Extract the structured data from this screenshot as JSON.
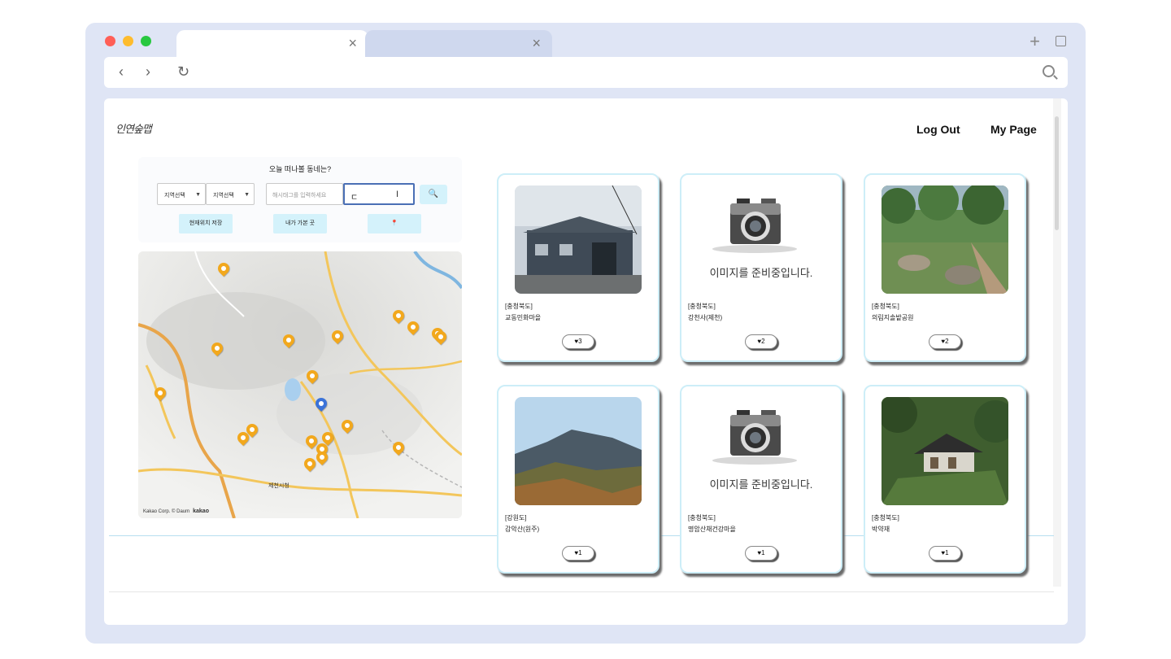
{
  "browser": {
    "tab_close": "×",
    "new_tab": "+",
    "nav_back": "‹",
    "nav_forward": "›",
    "nav_reload": "↻"
  },
  "header": {
    "logo_text": "인연숲맵",
    "logout_label": "Log Out",
    "mypage_label": "My Page"
  },
  "search": {
    "title": "오늘 떠나볼 동네는?",
    "region_select_1": "지역선택",
    "region_select_2": "지역선택",
    "hashtag_placeholder": "해시태그를 입력하세요",
    "query_value": "ㄷ",
    "search_button": "🔍",
    "current_location_button": "현재위치 저장",
    "my_places_button": "내가 가본 곳",
    "pin_button": "📍"
  },
  "map": {
    "city_label": "제천시청",
    "attribution": "Kakao Corp. © Daum",
    "brand": "kakao"
  },
  "cards": [
    {
      "region": "[충청북도]",
      "name": "교동민화마을",
      "likes": "3",
      "image": "photo-village"
    },
    {
      "region": "[충청북도]",
      "name": "강천사(제천)",
      "likes": "2",
      "image": "placeholder",
      "placeholder_text": "이미지를 준비중입니다."
    },
    {
      "region": "[충청북도]",
      "name": "의림지솔밭공원",
      "likes": "2",
      "image": "photo-park"
    },
    {
      "region": "[강원도]",
      "name": "감악산(원주)",
      "likes": "1",
      "image": "photo-mountain"
    },
    {
      "region": "[충청북도]",
      "name": "명암산채건강마을",
      "likes": "1",
      "image": "placeholder",
      "placeholder_text": "이미지를 준비중입니다."
    },
    {
      "region": "[충청북도]",
      "name": "박약재",
      "likes": "1",
      "image": "photo-hanok"
    }
  ],
  "colors": {
    "accent_button": "#d4f2fb",
    "card_border": "#cdeef8",
    "map_marker": "#f2a81d",
    "map_current": "#3b73d9"
  }
}
